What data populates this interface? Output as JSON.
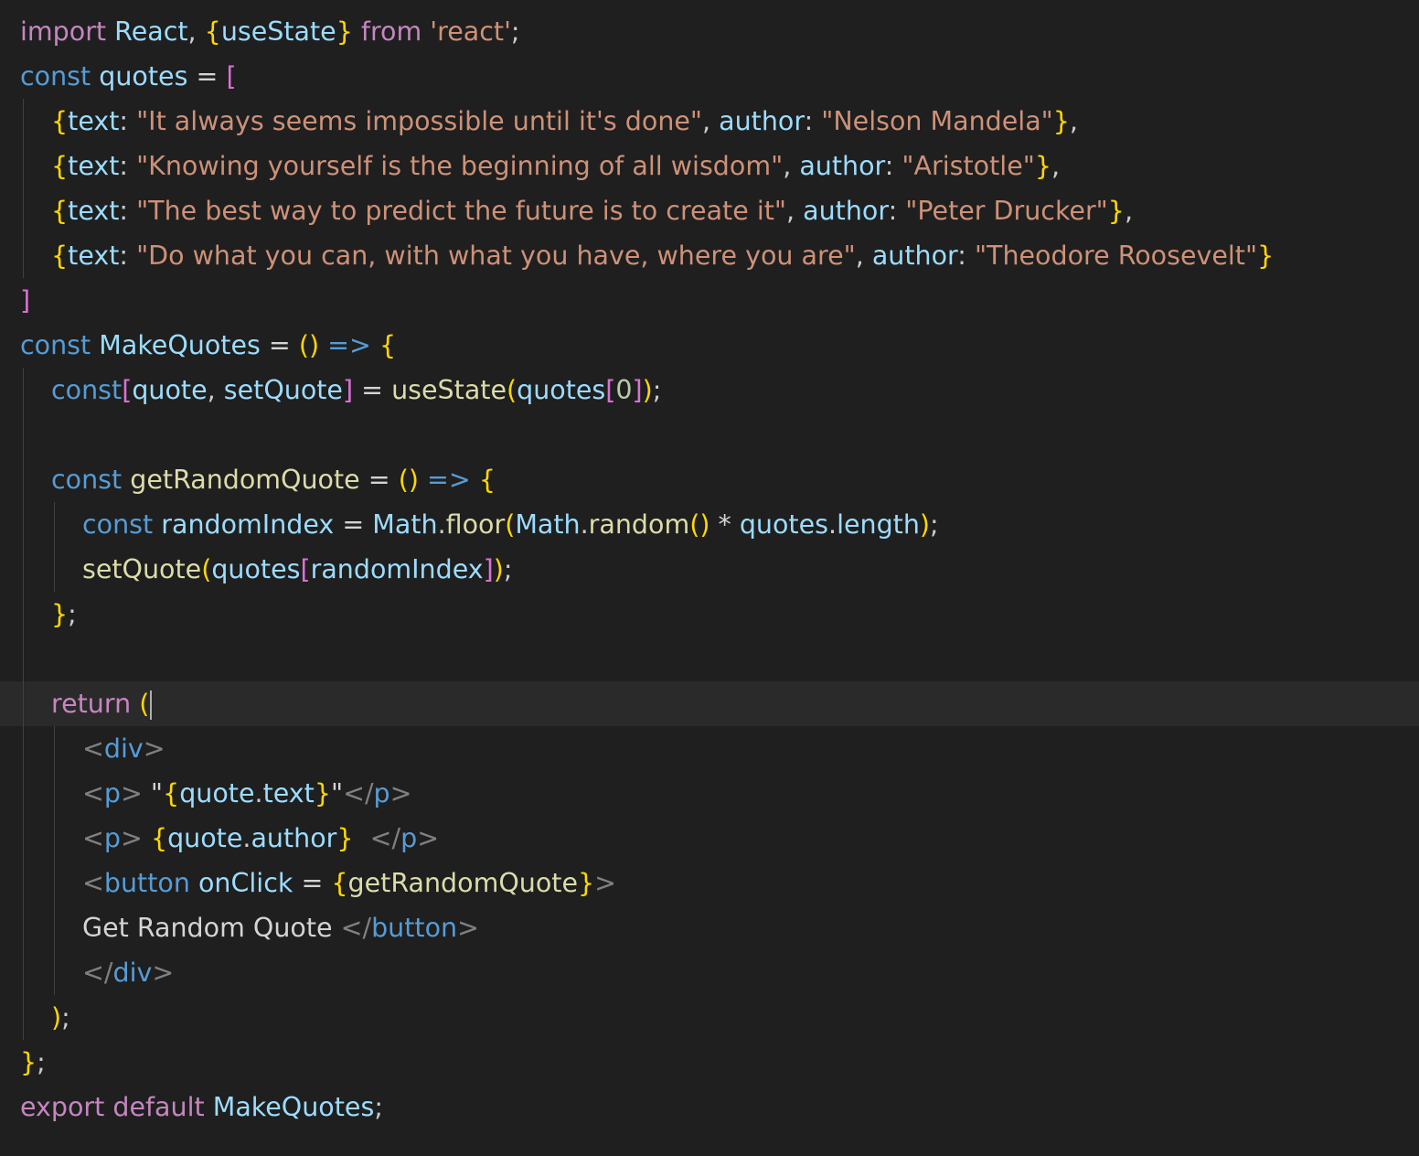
{
  "editor": {
    "colors": {
      "background": "#1f1f1f",
      "active_line": "#2a2a2a",
      "keyword": "#c586c0",
      "storage": "#569cd6",
      "variable": "#9cdcfe",
      "function": "#dcdcaa",
      "string": "#ce9178",
      "number": "#b5cea8",
      "bracket_level_1": "#ffd700",
      "bracket_level_2": "#da70d6"
    },
    "active_line_index": 15,
    "lines": [
      {
        "indent": 0,
        "tokens": [
          [
            "keyword",
            "import"
          ],
          [
            "text",
            " "
          ],
          [
            "var",
            "React"
          ],
          [
            "punc",
            ", "
          ],
          [
            "b1",
            "{"
          ],
          [
            "var",
            "useState"
          ],
          [
            "b1",
            "}"
          ],
          [
            "text",
            " "
          ],
          [
            "keyword",
            "from"
          ],
          [
            "text",
            " "
          ],
          [
            "str",
            "'react'"
          ],
          [
            "punc",
            ";"
          ]
        ]
      },
      {
        "indent": 0,
        "tokens": [
          [
            "storage",
            "const"
          ],
          [
            "text",
            " "
          ],
          [
            "var",
            "quotes"
          ],
          [
            "text",
            " "
          ],
          [
            "op",
            "="
          ],
          [
            "text",
            " "
          ],
          [
            "b2",
            "["
          ]
        ]
      },
      {
        "indent": 1,
        "tokens": [
          [
            "b1",
            "{"
          ],
          [
            "var",
            "text"
          ],
          [
            "punc",
            ": "
          ],
          [
            "str",
            "\"It always seems impossible until it's done\""
          ],
          [
            "punc",
            ", "
          ],
          [
            "var",
            "author"
          ],
          [
            "punc",
            ": "
          ],
          [
            "str",
            "\"Nelson Mandela\""
          ],
          [
            "b1",
            "}"
          ],
          [
            "punc",
            ","
          ]
        ]
      },
      {
        "indent": 1,
        "tokens": [
          [
            "b1",
            "{"
          ],
          [
            "var",
            "text"
          ],
          [
            "punc",
            ": "
          ],
          [
            "str",
            "\"Knowing yourself is the beginning of all wisdom\""
          ],
          [
            "punc",
            ", "
          ],
          [
            "var",
            "author"
          ],
          [
            "punc",
            ": "
          ],
          [
            "str",
            "\"Aristotle\""
          ],
          [
            "b1",
            "}"
          ],
          [
            "punc",
            ","
          ]
        ]
      },
      {
        "indent": 1,
        "tokens": [
          [
            "b1",
            "{"
          ],
          [
            "var",
            "text"
          ],
          [
            "punc",
            ": "
          ],
          [
            "str",
            "\"The best way to predict the future is to create it\""
          ],
          [
            "punc",
            ", "
          ],
          [
            "var",
            "author"
          ],
          [
            "punc",
            ": "
          ],
          [
            "str",
            "\"Peter Drucker\""
          ],
          [
            "b1",
            "}"
          ],
          [
            "punc",
            ","
          ]
        ]
      },
      {
        "indent": 1,
        "tokens": [
          [
            "b1",
            "{"
          ],
          [
            "var",
            "text"
          ],
          [
            "punc",
            ": "
          ],
          [
            "str",
            "\"Do what you can, with what you have, where you are\""
          ],
          [
            "punc",
            ", "
          ],
          [
            "var",
            "author"
          ],
          [
            "punc",
            ": "
          ],
          [
            "str",
            "\"Theodore Roosevelt\""
          ],
          [
            "b1",
            "}"
          ]
        ]
      },
      {
        "indent": 0,
        "tokens": [
          [
            "b2",
            "]"
          ]
        ]
      },
      {
        "indent": 0,
        "tokens": [
          [
            "storage",
            "const"
          ],
          [
            "text",
            " "
          ],
          [
            "var",
            "MakeQuotes"
          ],
          [
            "text",
            " "
          ],
          [
            "op",
            "="
          ],
          [
            "text",
            " "
          ],
          [
            "b1",
            "()"
          ],
          [
            "text",
            " "
          ],
          [
            "storage",
            "=>"
          ],
          [
            "text",
            " "
          ],
          [
            "b1",
            "{"
          ]
        ]
      },
      {
        "indent": 1,
        "tokens": [
          [
            "storage",
            "const"
          ],
          [
            "b2",
            "["
          ],
          [
            "var",
            "quote"
          ],
          [
            "punc",
            ", "
          ],
          [
            "var",
            "setQuote"
          ],
          [
            "b2",
            "]"
          ],
          [
            "text",
            " "
          ],
          [
            "op",
            "="
          ],
          [
            "text",
            " "
          ],
          [
            "fn",
            "useState"
          ],
          [
            "b1",
            "("
          ],
          [
            "var",
            "quotes"
          ],
          [
            "b2",
            "["
          ],
          [
            "num",
            "0"
          ],
          [
            "b2",
            "]"
          ],
          [
            "b1",
            ")"
          ],
          [
            "punc",
            ";"
          ]
        ]
      },
      {
        "indent": 0,
        "tokens": []
      },
      {
        "indent": 1,
        "tokens": [
          [
            "storage",
            "const"
          ],
          [
            "text",
            " "
          ],
          [
            "fn",
            "getRandomQuote"
          ],
          [
            "text",
            " "
          ],
          [
            "op",
            "="
          ],
          [
            "text",
            " "
          ],
          [
            "b1",
            "()"
          ],
          [
            "text",
            " "
          ],
          [
            "storage",
            "=>"
          ],
          [
            "text",
            " "
          ],
          [
            "b1",
            "{"
          ]
        ]
      },
      {
        "indent": 2,
        "tokens": [
          [
            "storage",
            "const"
          ],
          [
            "text",
            " "
          ],
          [
            "var",
            "randomIndex"
          ],
          [
            "text",
            " "
          ],
          [
            "op",
            "="
          ],
          [
            "text",
            " "
          ],
          [
            "var",
            "Math"
          ],
          [
            "punc",
            "."
          ],
          [
            "fn",
            "floor"
          ],
          [
            "b1",
            "("
          ],
          [
            "var",
            "Math"
          ],
          [
            "punc",
            "."
          ],
          [
            "fn",
            "random"
          ],
          [
            "b1",
            "()"
          ],
          [
            "text",
            " "
          ],
          [
            "op",
            "*"
          ],
          [
            "text",
            " "
          ],
          [
            "var",
            "quotes"
          ],
          [
            "punc",
            "."
          ],
          [
            "var",
            "length"
          ],
          [
            "b1",
            ")"
          ],
          [
            "punc",
            ";"
          ]
        ]
      },
      {
        "indent": 2,
        "tokens": [
          [
            "fn",
            "setQuote"
          ],
          [
            "b1",
            "("
          ],
          [
            "var",
            "quotes"
          ],
          [
            "b2",
            "["
          ],
          [
            "var",
            "randomIndex"
          ],
          [
            "b2",
            "]"
          ],
          [
            "b1",
            ")"
          ],
          [
            "punc",
            ";"
          ]
        ]
      },
      {
        "indent": 1,
        "tokens": [
          [
            "b1",
            "}"
          ],
          [
            "punc",
            ";"
          ]
        ]
      },
      {
        "indent": 0,
        "tokens": []
      },
      {
        "indent": 1,
        "tokens": [
          [
            "keyword",
            "return"
          ],
          [
            "text",
            " "
          ],
          [
            "b1",
            "("
          ]
        ]
      },
      {
        "indent": 2,
        "tokens": [
          [
            "tagp",
            "<"
          ],
          [
            "tag",
            "div"
          ],
          [
            "tagp",
            ">"
          ]
        ]
      },
      {
        "indent": 2,
        "tokens": [
          [
            "tagp",
            "<"
          ],
          [
            "tag",
            "p"
          ],
          [
            "tagp",
            ">"
          ],
          [
            "text",
            " \""
          ],
          [
            "b1",
            "{"
          ],
          [
            "var",
            "quote"
          ],
          [
            "punc",
            "."
          ],
          [
            "var",
            "text"
          ],
          [
            "b1",
            "}"
          ],
          [
            "text",
            "\""
          ],
          [
            "tagp",
            "</"
          ],
          [
            "tag",
            "p"
          ],
          [
            "tagp",
            ">"
          ]
        ]
      },
      {
        "indent": 2,
        "tokens": [
          [
            "tagp",
            "<"
          ],
          [
            "tag",
            "p"
          ],
          [
            "tagp",
            ">"
          ],
          [
            "text",
            " "
          ],
          [
            "b1",
            "{"
          ],
          [
            "var",
            "quote"
          ],
          [
            "punc",
            "."
          ],
          [
            "var",
            "author"
          ],
          [
            "b1",
            "}"
          ],
          [
            "text",
            "  "
          ],
          [
            "tagp",
            "</"
          ],
          [
            "tag",
            "p"
          ],
          [
            "tagp",
            ">"
          ]
        ]
      },
      {
        "indent": 2,
        "tokens": [
          [
            "tagp",
            "<"
          ],
          [
            "tag",
            "button"
          ],
          [
            "text",
            " "
          ],
          [
            "var",
            "onClick"
          ],
          [
            "text",
            " "
          ],
          [
            "op",
            "="
          ],
          [
            "text",
            " "
          ],
          [
            "b1",
            "{"
          ],
          [
            "fn",
            "getRandomQuote"
          ],
          [
            "b1",
            "}"
          ],
          [
            "tagp",
            ">"
          ]
        ]
      },
      {
        "indent": 2,
        "tokens": [
          [
            "text",
            "Get Random Quote "
          ],
          [
            "tagp",
            "</"
          ],
          [
            "tag",
            "button"
          ],
          [
            "tagp",
            ">"
          ]
        ]
      },
      {
        "indent": 2,
        "tokens": [
          [
            "tagp",
            "</"
          ],
          [
            "tag",
            "div"
          ],
          [
            "tagp",
            ">"
          ]
        ]
      },
      {
        "indent": 1,
        "tokens": [
          [
            "b1",
            ")"
          ],
          [
            "punc",
            ";"
          ]
        ]
      },
      {
        "indent": 0,
        "tokens": [
          [
            "b1",
            "}"
          ],
          [
            "punc",
            ";"
          ]
        ]
      },
      {
        "indent": 0,
        "tokens": [
          [
            "keyword",
            "export"
          ],
          [
            "text",
            " "
          ],
          [
            "keyword",
            "default"
          ],
          [
            "text",
            " "
          ],
          [
            "var",
            "MakeQuotes"
          ],
          [
            "punc",
            ";"
          ]
        ]
      }
    ]
  }
}
